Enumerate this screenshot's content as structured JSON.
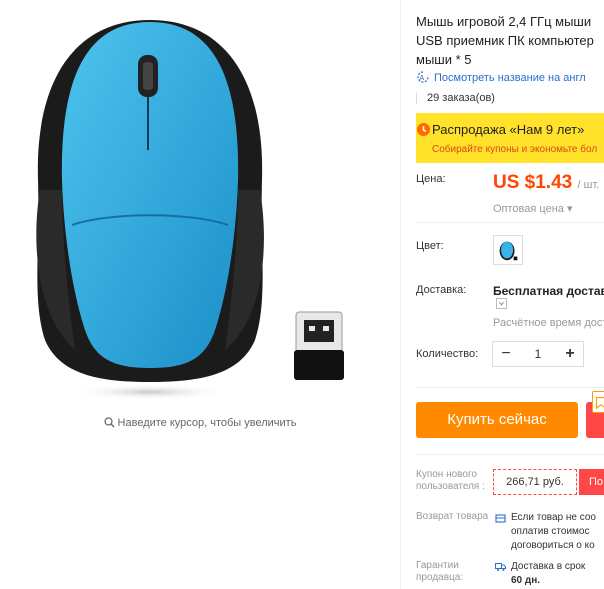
{
  "product": {
    "title": "Мышь игровой 2,4 ГГц мыши USB приемник ПК компьютер мыши * 5",
    "translate_link": "Посмотреть название на англ",
    "orders": "29 заказа(ов)",
    "zoom_hint": "Наведите курсор, чтобы увеличить"
  },
  "promo": {
    "title": "Распродажа «Нам 9 лет»",
    "subtitle": "Собирайте купоны и экономьте бол",
    "bg_color": "#ffe229",
    "text_color": "#e0451c"
  },
  "price": {
    "label": "Цена:",
    "value": "US $1.43",
    "unit": "/ шт.",
    "wholesale": "Оптовая цена ▾",
    "color": "#ff4500"
  },
  "color_option": {
    "label": "Цвет:"
  },
  "shipping": {
    "label": "Доставка:",
    "method": "Бесплатная доставка",
    "estimate": "Расчётное время дост"
  },
  "quantity": {
    "label": "Количество:",
    "minus": "−",
    "value": "1",
    "plus": "+"
  },
  "actions": {
    "buy_now": "Купить сейчас",
    "buy_color": "#ff8a00",
    "cart_color": "#ff4747"
  },
  "coupon": {
    "label": "Купон нового пользователя :",
    "amount": "266,71 руб.",
    "get": "По"
  },
  "returns": {
    "label": "Возврат товара",
    "lines": [
      "Если товар не соо",
      "оплатив стоимос",
      "договориться о ко"
    ]
  },
  "guarantee": {
    "label": "Гарантии продавца:",
    "lines": [
      "Доставка в срок",
      "60 дн."
    ]
  }
}
